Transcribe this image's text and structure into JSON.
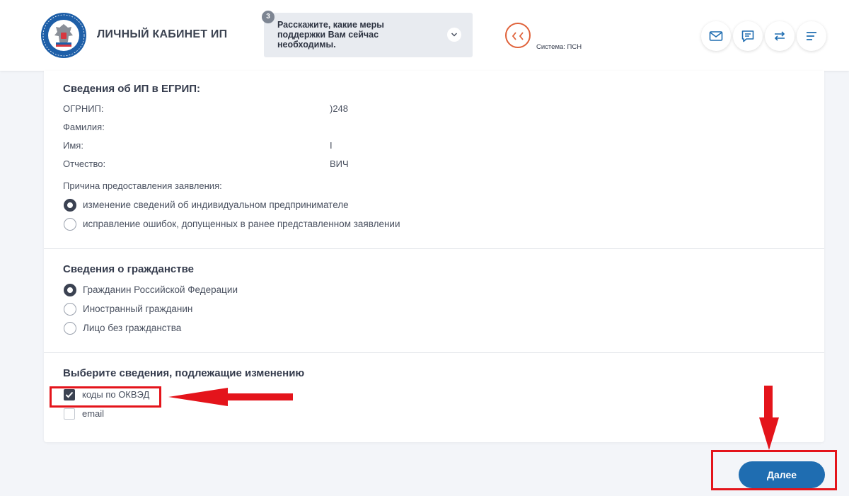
{
  "header": {
    "title": "ЛИЧНЫЙ КАБИНЕТ ИП",
    "survey": {
      "badge": "3",
      "text": "Расскажите, какие меры поддержки Вам сейчас необходимы."
    },
    "system_label": "Система: ПСН",
    "icons": [
      "mail-icon",
      "chat-icon",
      "swap-icon",
      "menu-icon"
    ]
  },
  "egrip": {
    "title": "Сведения об ИП в ЕГРИП:",
    "fields": [
      {
        "label": "ОГРНИП:",
        "value": ")248"
      },
      {
        "label": "Фамилия:",
        "value": ""
      },
      {
        "label": "Имя:",
        "value": "I"
      },
      {
        "label": "Отчество:",
        "value": "ВИЧ"
      }
    ],
    "reason_label": "Причина предоставления заявления:",
    "reasons": [
      {
        "label": "изменение сведений об индивидуальном предпринимателе",
        "selected": true
      },
      {
        "label": "исправление ошибок, допущенных в ранее представленном заявлении",
        "selected": false
      }
    ]
  },
  "citizenship": {
    "title": "Сведения о гражданстве",
    "options": [
      {
        "label": "Гражданин Российской Федерации",
        "selected": true
      },
      {
        "label": "Иностранный гражданин",
        "selected": false
      },
      {
        "label": "Лицо без гражданства",
        "selected": false
      }
    ]
  },
  "changes": {
    "title": "Выберите сведения, подлежащие изменению",
    "options": [
      {
        "label": "коды по ОКВЭД",
        "checked": true
      },
      {
        "label": "email",
        "checked": false
      }
    ]
  },
  "next_button": "Далее",
  "colors": {
    "primary": "#1f6db1",
    "annotation": "#e4141b",
    "system_accent": "#e0623a",
    "background": "#f3f5f9"
  }
}
